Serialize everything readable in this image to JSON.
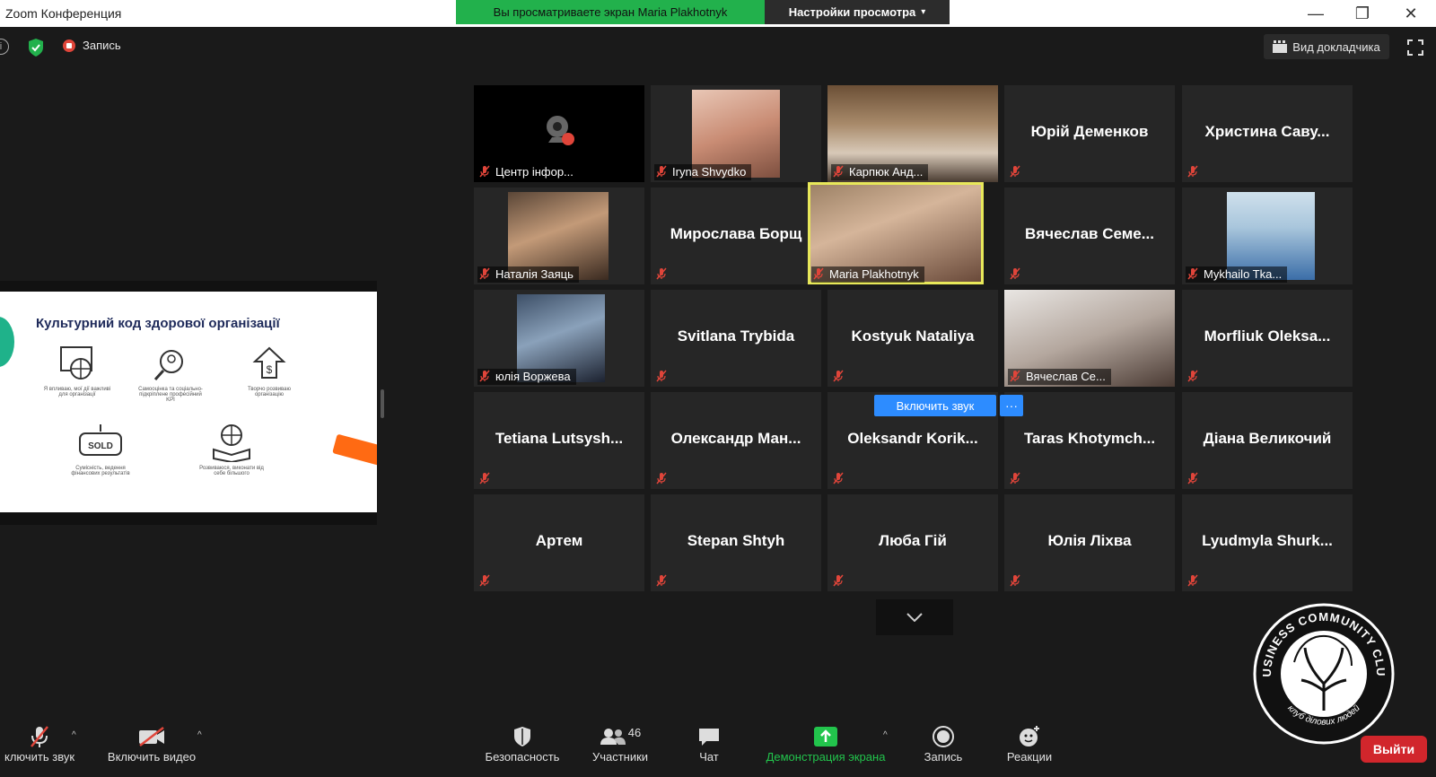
{
  "window": {
    "title": "Zoom Конференция",
    "share_banner": "Вы просматриваете экран Maria Plakhotnyk",
    "view_options": "Настройки просмотра"
  },
  "topbar": {
    "record_label": "Запись",
    "speaker_view": "Вид докладчика"
  },
  "slide": {
    "title": "Культурний код здорової організації",
    "items": [
      "Я впливаю, мої дії важливі для організації",
      "Самооцінка та соціально-підкріплене професійний KPI",
      "Творчо розвиваю організацію",
      "Сумісність, ведення фінансових результатів",
      "Розвиваюся, виконати від себе більшого"
    ]
  },
  "gallery": {
    "tiles": [
      {
        "name": "Центр інфор...",
        "type": "video"
      },
      {
        "name": "Iryna Shvydko",
        "type": "video"
      },
      {
        "name": "Карпюк Анд...",
        "type": "video"
      },
      {
        "name": "Юрій Деменков",
        "type": "name"
      },
      {
        "name": "Христина Саву...",
        "type": "name"
      },
      {
        "name": "Наталія Заяць",
        "type": "video"
      },
      {
        "name": "Мирослава Борщ",
        "type": "name"
      },
      {
        "name": "Maria Plakhotnyk",
        "type": "video",
        "active": true
      },
      {
        "name": "Вячеслав Семе...",
        "type": "name"
      },
      {
        "name": "Mykhailo Tka...",
        "type": "video"
      },
      {
        "name": "юлія Воржева",
        "type": "video"
      },
      {
        "name": "Svitlana Trybida",
        "type": "name"
      },
      {
        "name": "Kostyuk Nataliya",
        "type": "name"
      },
      {
        "name": "Вячеслав Се...",
        "type": "video"
      },
      {
        "name": "Morfliuk Oleksa...",
        "type": "name"
      },
      {
        "name": "Tetiana Lutsysh...",
        "type": "name"
      },
      {
        "name": "Олександр Ман...",
        "type": "name"
      },
      {
        "name": "Oleksandr Korik...",
        "type": "name"
      },
      {
        "name": "Taras Khotymch...",
        "type": "name"
      },
      {
        "name": "Діана Великочий",
        "type": "name"
      },
      {
        "name": "Артем",
        "type": "name"
      },
      {
        "name": "Stepan Shtyh",
        "type": "name"
      },
      {
        "name": "Люба Гій",
        "type": "name"
      },
      {
        "name": "Юлія Ліхва",
        "type": "name"
      },
      {
        "name": "Lyudmyla Shurk...",
        "type": "name"
      }
    ],
    "unmute_label": "Включить звук",
    "more_label": "···"
  },
  "bottombar": {
    "mic_label": "ключить звук",
    "video_label": "Включить видео",
    "security_label": "Безопасность",
    "participants_label": "Участники",
    "participants_count": "46",
    "chat_label": "Чат",
    "share_label": "Демонстрация экрана",
    "record_label": "Запись",
    "reactions_label": "Реакции",
    "leave_label": "Выйти"
  },
  "logo": {
    "text_top": "BUSINESS COMMUNITY CLUB",
    "text_bottom": "клуб ділових людей"
  },
  "colors": {
    "background": "#1a1a1a",
    "tile": "#262626",
    "zoom_blue": "#2d8cff",
    "share_green": "#22b14c",
    "leave_red": "#d1262c",
    "active_speaker": "#e8e85a"
  }
}
